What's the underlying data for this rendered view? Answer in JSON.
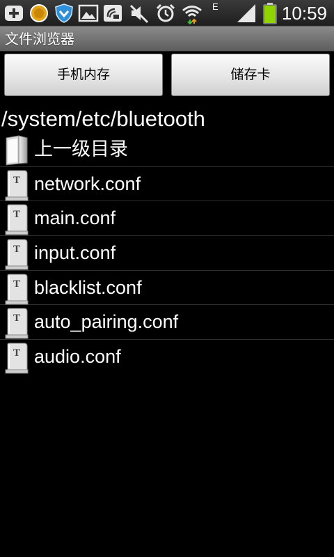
{
  "status_bar": {
    "clock": "10:59",
    "network_type": "E",
    "icons": [
      "add-notification-icon",
      "coin-icon",
      "shield-icon",
      "gallery-icon",
      "satellite-dish-icon",
      "mute-icon",
      "alarm-icon",
      "wifi-icon",
      "signal-icon",
      "battery-icon"
    ],
    "battery_color": "#8fd400"
  },
  "app": {
    "title": "文件浏览器"
  },
  "storage_buttons": {
    "phone_memory": "手机内存",
    "sd_card": "储存卡"
  },
  "current_path": "/system/etc/bluetooth",
  "file_list": {
    "parent": {
      "label": "上一级目录",
      "icon": "parent-folder-icon"
    },
    "files": [
      {
        "label": "network.conf",
        "icon": "text-file-icon"
      },
      {
        "label": "main.conf",
        "icon": "text-file-icon"
      },
      {
        "label": "input.conf",
        "icon": "text-file-icon"
      },
      {
        "label": "blacklist.conf",
        "icon": "text-file-icon"
      },
      {
        "label": "auto_pairing.conf",
        "icon": "text-file-icon"
      },
      {
        "label": "audio.conf",
        "icon": "text-file-icon"
      }
    ]
  }
}
